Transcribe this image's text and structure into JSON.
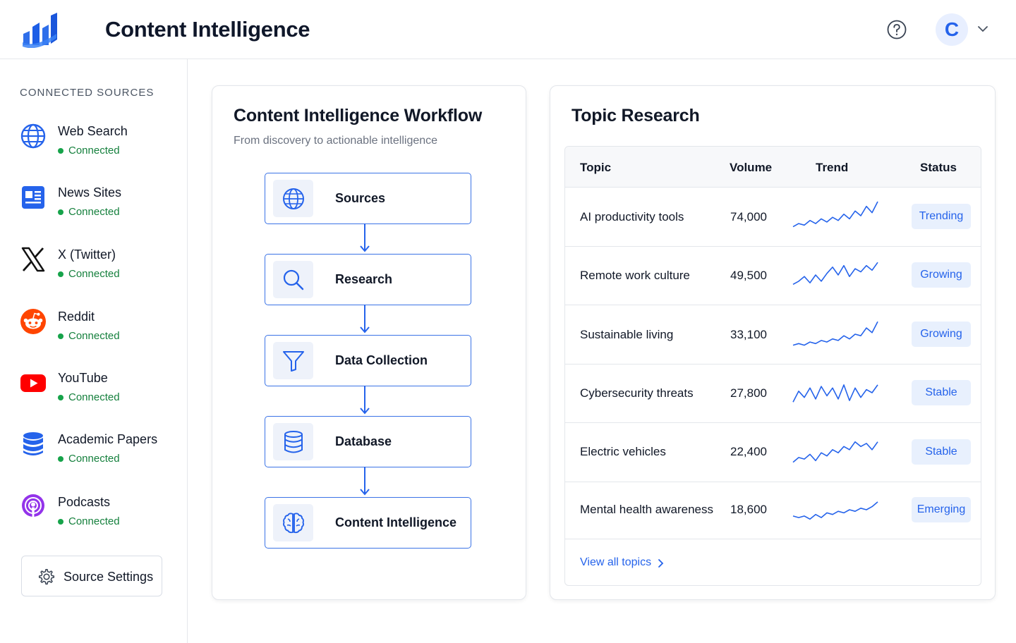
{
  "header": {
    "title": "Content Intelligence",
    "logo_icon": "bar-chart-logo-icon",
    "help_icon": "help-circle-icon",
    "avatar_initial": "C",
    "avatar_caret_icon": "chevron-down-icon"
  },
  "sidebar": {
    "heading": "CONNECTED SOURCES",
    "sources": [
      {
        "name": "Web Search",
        "status": "Connected",
        "icon": "globe-icon"
      },
      {
        "name": "News Sites",
        "status": "Connected",
        "icon": "newspaper-icon"
      },
      {
        "name": "X (Twitter)",
        "status": "Connected",
        "icon": "x-logo-icon"
      },
      {
        "name": "Reddit",
        "status": "Connected",
        "icon": "reddit-icon"
      },
      {
        "name": "YouTube",
        "status": "Connected",
        "icon": "youtube-icon"
      },
      {
        "name": "Academic Papers",
        "status": "Connected",
        "icon": "database-icon"
      },
      {
        "name": "Podcasts",
        "status": "Connected",
        "icon": "podcast-icon"
      }
    ],
    "settings_button": {
      "label": "Source Settings",
      "icon": "gear-icon"
    }
  },
  "workflow": {
    "title": "Content Intelligence Workflow",
    "subtitle": "From discovery to actionable intelligence",
    "steps": [
      {
        "label": "Sources",
        "icon": "globe-icon"
      },
      {
        "label": "Research",
        "icon": "search-icon"
      },
      {
        "label": "Data Collection",
        "icon": "filter-icon"
      },
      {
        "label": "Database",
        "icon": "database-icon"
      },
      {
        "label": "Content Intelligence",
        "icon": "brain-icon"
      }
    ]
  },
  "topic_research": {
    "title": "Topic Research",
    "columns": [
      "Topic",
      "Volume",
      "Trend",
      "Status"
    ],
    "rows": [
      {
        "topic": "AI productivity tools",
        "volume": "74,000",
        "status": "Trending",
        "trend": [
          2,
          4,
          3,
          6,
          4,
          7,
          5,
          8,
          6,
          10,
          7,
          12,
          9,
          15,
          11,
          18
        ]
      },
      {
        "topic": "Remote work culture",
        "volume": "49,500",
        "status": "Growing",
        "trend": [
          3,
          5,
          8,
          4,
          9,
          5,
          10,
          14,
          9,
          15,
          8,
          13,
          11,
          15,
          12,
          17
        ]
      },
      {
        "topic": "Sustainable living",
        "volume": "33,100",
        "status": "Growing",
        "trend": [
          2,
          3,
          2,
          4,
          3,
          5,
          4,
          6,
          5,
          8,
          6,
          9,
          8,
          13,
          10,
          17
        ]
      },
      {
        "topic": "Cybersecurity threats",
        "volume": "27,800",
        "status": "Stable",
        "trend": [
          3,
          10,
          6,
          12,
          5,
          13,
          7,
          12,
          5,
          14,
          4,
          12,
          6,
          11,
          9,
          14
        ]
      },
      {
        "topic": "Electric vehicles",
        "volume": "22,400",
        "status": "Stable",
        "trend": [
          2,
          5,
          4,
          7,
          3,
          8,
          6,
          10,
          8,
          12,
          10,
          15,
          12,
          14,
          10,
          15
        ]
      },
      {
        "topic": "Mental health awareness",
        "volume": "18,600",
        "status": "Emerging",
        "trend": [
          5,
          4,
          5,
          3,
          6,
          4,
          7,
          6,
          8,
          7,
          9,
          8,
          10,
          9,
          11,
          14
        ]
      }
    ],
    "view_all_label": "View all topics",
    "view_all_icon": "chevron-right-icon"
  },
  "colors": {
    "accent": "#2563eb",
    "connected": "#16a34a",
    "badge_bg": "#e8f0fd",
    "step_border": "#3b73e6"
  }
}
